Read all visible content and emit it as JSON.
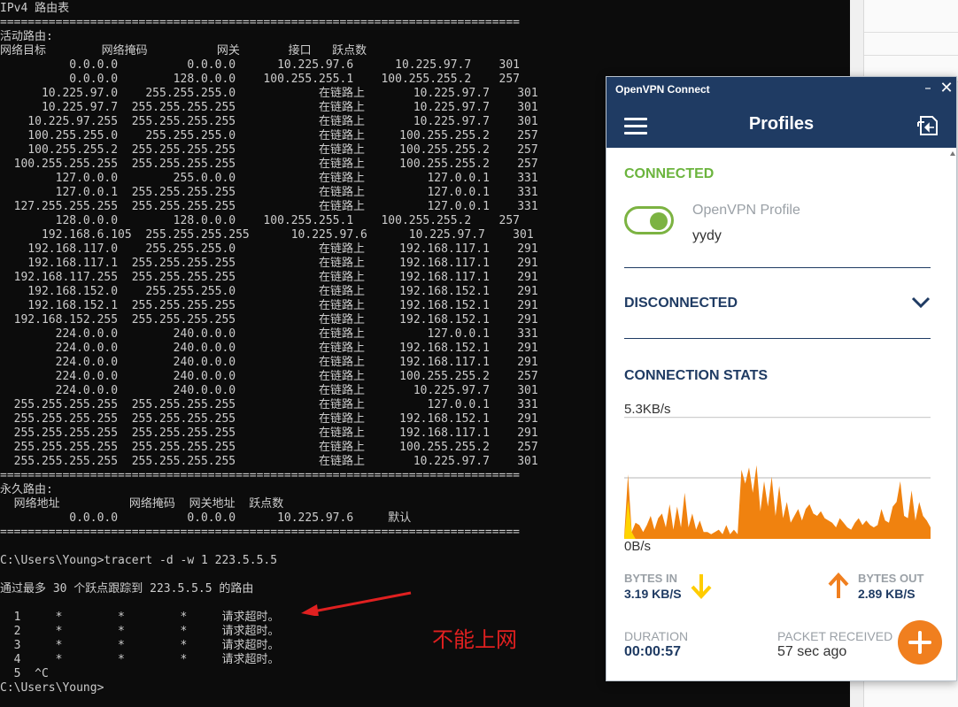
{
  "console": {
    "lines": [
      "IPv4 路由表",
      "===========================================================================",
      "活动路由:",
      "网络目标        网络掩码          网关       接口   跃点数",
      "          0.0.0.0          0.0.0.0      10.225.97.6      10.225.97.7    301",
      "          0.0.0.0        128.0.0.0    100.255.255.1    100.255.255.2    257",
      "      10.225.97.0    255.255.255.0            在链路上       10.225.97.7    301",
      "      10.225.97.7  255.255.255.255            在链路上       10.225.97.7    301",
      "    10.225.97.255  255.255.255.255            在链路上       10.225.97.7    301",
      "    100.255.255.0    255.255.255.0            在链路上     100.255.255.2    257",
      "    100.255.255.2  255.255.255.255            在链路上     100.255.255.2    257",
      "  100.255.255.255  255.255.255.255            在链路上     100.255.255.2    257",
      "        127.0.0.0        255.0.0.0            在链路上         127.0.0.1    331",
      "        127.0.0.1  255.255.255.255            在链路上         127.0.0.1    331",
      "  127.255.255.255  255.255.255.255            在链路上         127.0.0.1    331",
      "        128.0.0.0        128.0.0.0    100.255.255.1    100.255.255.2    257",
      "      192.168.6.105  255.255.255.255      10.225.97.6      10.225.97.7    301",
      "    192.168.117.0    255.255.255.0            在链路上     192.168.117.1    291",
      "    192.168.117.1  255.255.255.255            在链路上     192.168.117.1    291",
      "  192.168.117.255  255.255.255.255            在链路上     192.168.117.1    291",
      "    192.168.152.0    255.255.255.0            在链路上     192.168.152.1    291",
      "    192.168.152.1  255.255.255.255            在链路上     192.168.152.1    291",
      "  192.168.152.255  255.255.255.255            在链路上     192.168.152.1    291",
      "        224.0.0.0        240.0.0.0            在链路上         127.0.0.1    331",
      "        224.0.0.0        240.0.0.0            在链路上     192.168.152.1    291",
      "        224.0.0.0        240.0.0.0            在链路上     192.168.117.1    291",
      "        224.0.0.0        240.0.0.0            在链路上     100.255.255.2    257",
      "        224.0.0.0        240.0.0.0            在链路上       10.225.97.7    301",
      "  255.255.255.255  255.255.255.255            在链路上         127.0.0.1    331",
      "  255.255.255.255  255.255.255.255            在链路上     192.168.152.1    291",
      "  255.255.255.255  255.255.255.255            在链路上     192.168.117.1    291",
      "  255.255.255.255  255.255.255.255            在链路上     100.255.255.2    257",
      "  255.255.255.255  255.255.255.255            在链路上       10.225.97.7    301",
      "===========================================================================",
      "永久路由:",
      "  网络地址          网络掩码  网关地址  跃点数",
      "          0.0.0.0          0.0.0.0      10.225.97.6     默认",
      "===========================================================================",
      "",
      "C:\\Users\\Young>tracert -d -w 1 223.5.5.5",
      "",
      "通过最多 30 个跃点跟踪到 223.5.5.5 的路由",
      "",
      "  1     *        *        *     请求超时。",
      "  2     *        *        *     请求超时。",
      "  3     *        *        *     请求超时。",
      "  4     *        *        *     请求超时。",
      "  5  ^C",
      "C:\\Users\\Young>"
    ]
  },
  "annotation": {
    "text": "不能上网",
    "color": "#e02020"
  },
  "openvpn": {
    "window_title": "OpenVPN Connect",
    "minimize_symbol": "–",
    "close_symbol": "✕",
    "header_title": "Profiles",
    "connected_label": "CONNECTED",
    "profile": {
      "type": "OpenVPN Profile",
      "name": "yydy",
      "toggle_on": true
    },
    "disconnected_label": "DISCONNECTED",
    "stats": {
      "title": "CONNECTION STATS",
      "rate_max": "5.3KB/s",
      "rate_min": "0B/s",
      "bytes_in_label": "BYTES IN",
      "bytes_in_value": "3.19 KB/S",
      "bytes_out_label": "BYTES OUT",
      "bytes_out_value": "2.89 KB/S",
      "duration_label": "DURATION",
      "duration_value": "00:00:57",
      "packet_label": "PACKET RECEIVED",
      "packet_value": "57 sec ago"
    },
    "graph": {
      "max_kbps": 5.3,
      "outgoing_color": "#f0820f",
      "incoming_color": "#ffd400",
      "outgoing": [
        0.1,
        2.8,
        0.3,
        0.7,
        0.6,
        0.3,
        0.6,
        1.0,
        0.4,
        0.9,
        1.1,
        0.5,
        1.5,
        0.4,
        1.4,
        0.5,
        2.0,
        0.5,
        1.1,
        0.4,
        0.8,
        0.3,
        0.3,
        0.2,
        0.3,
        0.4,
        0.2,
        0.6,
        0.2,
        0.4,
        0.2,
        3.0,
        2.4,
        3.1,
        2.0,
        3.2,
        1.2,
        2.5,
        1.4,
        2.7,
        1.0,
        2.3,
        0.9,
        1.6,
        0.7,
        1.0,
        1.3,
        0.8,
        1.3,
        1.5,
        1.1,
        1.0,
        1.2,
        0.9,
        0.8,
        0.7,
        0.5,
        0.9,
        0.7,
        0.5,
        0.4,
        0.7,
        0.9,
        0.6,
        0.8,
        0.6,
        0.5,
        0.6,
        1.3,
        0.8,
        0.7,
        1.4,
        1.6,
        2.5,
        1.0,
        0.9,
        2.1,
        0.8,
        1.6,
        1.0,
        0.8,
        0.5
      ],
      "incoming": [
        0,
        1.7,
        0.3,
        0,
        0,
        0,
        0,
        0,
        0,
        0,
        0,
        0,
        0,
        0,
        0,
        0,
        0,
        0,
        0,
        0,
        0,
        0,
        0,
        0,
        0,
        0,
        0,
        0,
        0,
        0,
        0,
        0,
        0,
        0,
        0,
        0,
        0,
        0,
        0,
        0,
        0,
        0,
        0,
        0,
        0,
        0,
        0,
        0,
        0,
        0,
        0,
        0,
        0,
        0,
        0,
        0,
        0,
        0,
        0,
        0,
        0,
        0,
        0,
        0,
        0,
        0,
        0,
        0,
        0,
        0,
        0,
        0,
        0,
        0,
        0,
        0,
        0,
        0,
        0,
        0,
        0,
        0
      ]
    }
  }
}
